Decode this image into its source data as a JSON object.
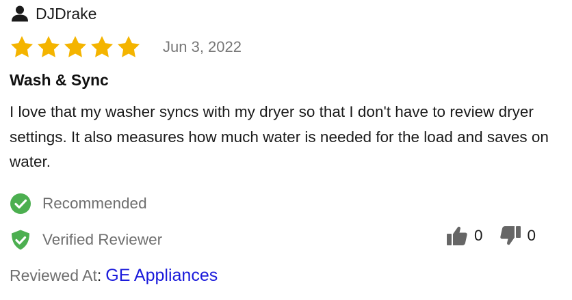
{
  "review": {
    "author": {
      "name": "DJDrake",
      "icon": "person-icon"
    },
    "rating": {
      "stars": 5,
      "max": 5,
      "color": "#f4b400"
    },
    "date": "Jun 3, 2022",
    "title": "Wash & Sync",
    "body": "I love that my washer syncs with my dryer so that I don't have to review dryer settings. It also measures how much water is needed for the load and saves on water.",
    "badges": {
      "recommended": {
        "label": "Recommended",
        "icon": "check-circle-icon",
        "color": "#4caf50"
      },
      "verified": {
        "label": "Verified Reviewer",
        "icon": "shield-check-icon",
        "color": "#4caf50"
      }
    },
    "votes": {
      "helpful": {
        "count": "0",
        "icon": "thumbs-up-icon"
      },
      "unhelpful": {
        "count": "0",
        "icon": "thumbs-down-icon"
      }
    },
    "reviewed_at": {
      "label": "Reviewed At",
      "separator": ":",
      "site": "GE Appliances",
      "link_color": "#1a1adb"
    }
  }
}
